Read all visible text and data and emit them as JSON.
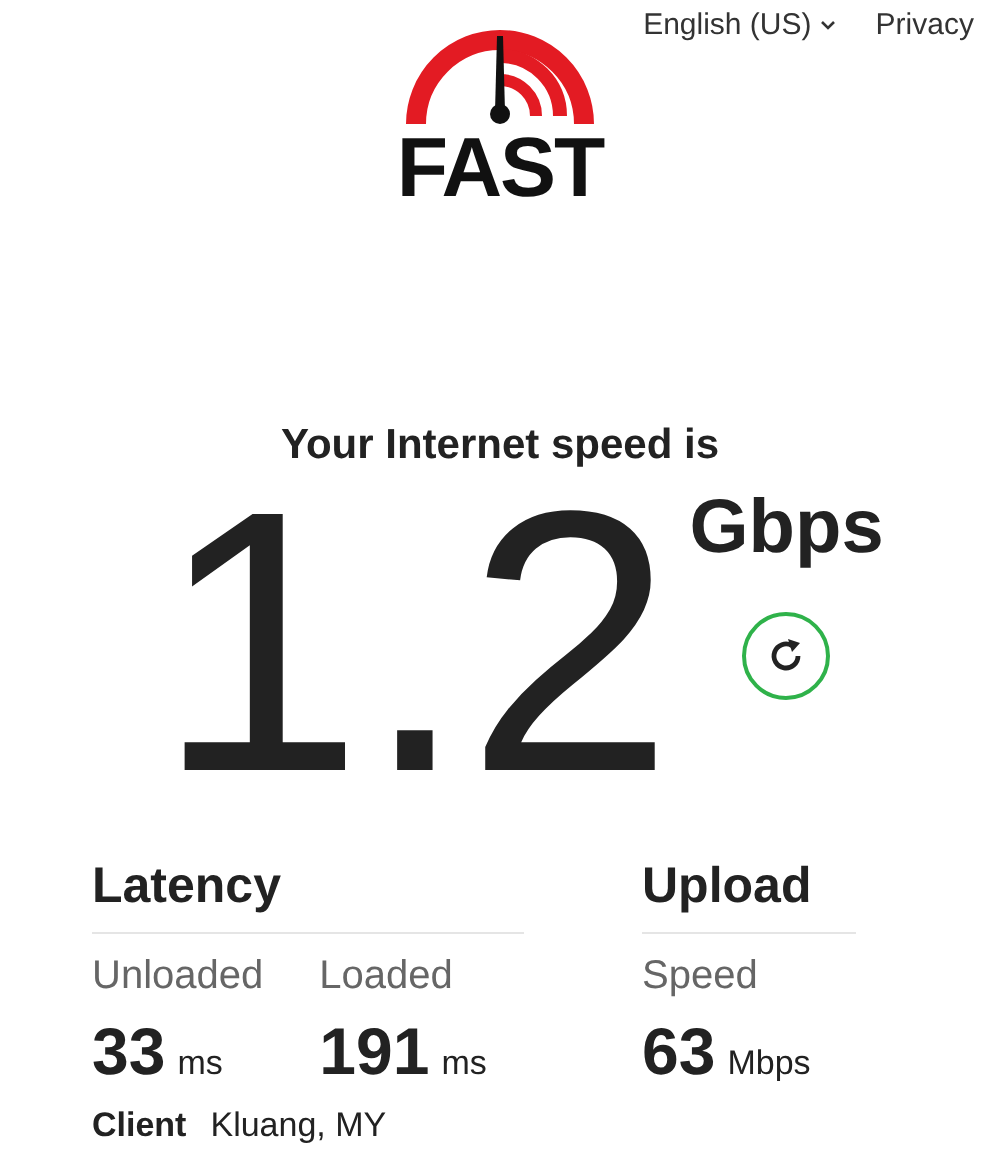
{
  "logo": {
    "text": "FAST"
  },
  "nav": {
    "language": "English (US)",
    "privacy": "Privacy"
  },
  "speed": {
    "heading": "Your Internet speed is",
    "value": "1.2",
    "unit": "Gbps"
  },
  "latency": {
    "title": "Latency",
    "items": [
      {
        "label": "Unloaded",
        "value": "33",
        "unit": "ms"
      },
      {
        "label": "Loaded",
        "value": "191",
        "unit": "ms"
      }
    ]
  },
  "upload": {
    "title": "Upload",
    "items": [
      {
        "label": "Speed",
        "value": "63",
        "unit": "Mbps"
      }
    ]
  },
  "client": {
    "label": "Client",
    "value": "Kluang, MY"
  }
}
